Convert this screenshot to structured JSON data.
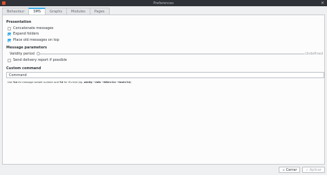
{
  "window": {
    "title": "Preferences",
    "close_glyph": "×"
  },
  "tabs": [
    {
      "label": "Behaviour",
      "active": false
    },
    {
      "label": "SMS",
      "active": true
    },
    {
      "label": "Graphs",
      "active": false
    },
    {
      "label": "Modules",
      "active": false
    },
    {
      "label": "Pages",
      "active": false
    }
  ],
  "presentation": {
    "title": "Presentation",
    "options": [
      {
        "label": "Concatenate messages",
        "checked": false
      },
      {
        "label": "Expand folders",
        "checked": true
      },
      {
        "label": "Place old messages on top",
        "checked": true
      }
    ]
  },
  "message_parameters": {
    "title": "Message parameters",
    "validity_label": "Validity period",
    "validity_value": "Undefined",
    "validity_fraction": 0,
    "delivery_report": {
      "label": "Send delivery report if possible",
      "checked": false
    }
  },
  "custom_command": {
    "title": "Custom command",
    "value": "Command",
    "hint_use": "Use",
    "hint_n": "%n",
    "hint_mid": "for message sender number and",
    "hint_t": "%t",
    "hint_mid2": "for it's text (eg.",
    "hint_example": "zenity --info --title=%n --text=%t",
    "hint_end": ")."
  },
  "buttons": {
    "cancel": {
      "label": "Cerrar",
      "icon": "cancel-icon"
    },
    "apply": {
      "label": "Aplicar",
      "icon": "apply-icon"
    }
  },
  "colors": {
    "accent": "#3daee9",
    "titlebar": "#2f3236"
  }
}
